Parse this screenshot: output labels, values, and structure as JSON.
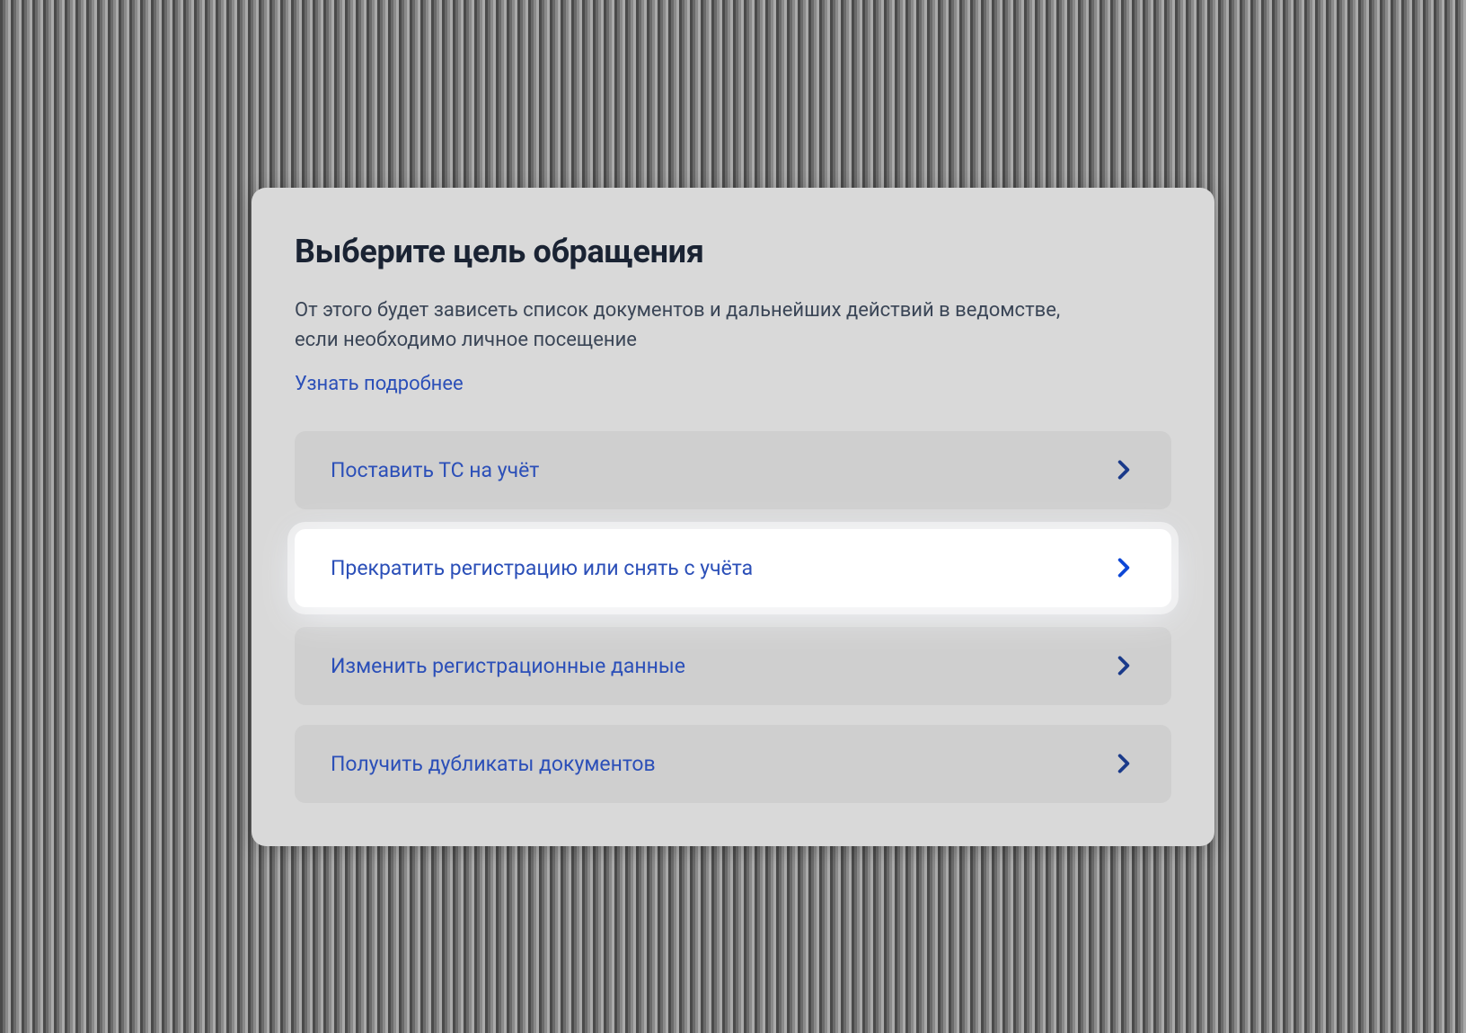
{
  "header": {
    "title": "Выберите цель обращения",
    "description": "От этого будет зависеть список документов и дальнейших действий в ведомстве, если необходимо личное посещение",
    "learn_more": "Узнать подробнее"
  },
  "options": [
    {
      "label": "Поставить ТС на учёт",
      "highlighted": false
    },
    {
      "label": "Прекратить регистрацию или снять с учёта",
      "highlighted": true
    },
    {
      "label": "Изменить регистрационные данные",
      "highlighted": false
    },
    {
      "label": "Получить дубликаты документов",
      "highlighted": false
    }
  ]
}
